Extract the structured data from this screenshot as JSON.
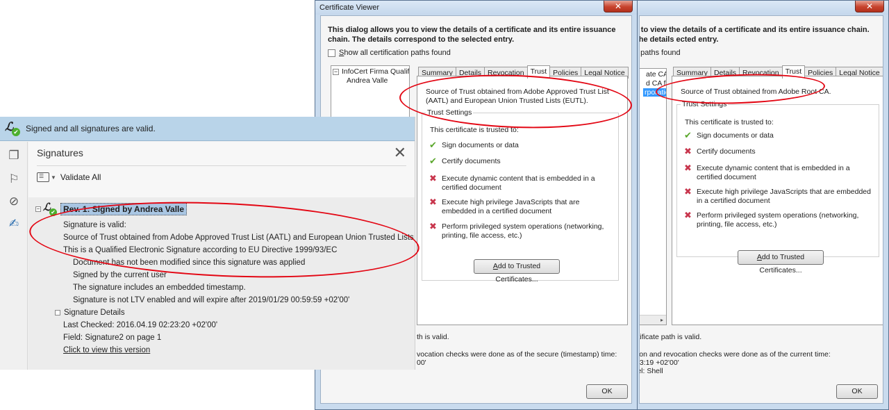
{
  "dialog": {
    "title": "Certificate Viewer",
    "close_symbol": "✕",
    "description": "This dialog allows you to view the details of a certificate and its entire issuance chain. The details correspond to the selected entry.",
    "show_all_paths_label": "Show all certification paths found",
    "tree": [
      {
        "expander": "−",
        "label": "InfoCert Firma Qualificata"
      },
      {
        "label": "Andrea Valle"
      }
    ],
    "tabs": [
      "Summary",
      "Details",
      "Revocation",
      "Trust",
      "Policies",
      "Legal Notice"
    ],
    "active_tab": "Trust",
    "trust_source": "Source of Trust obtained from Adobe Approved Trust List (AATL) and European Union Trusted Lists (EUTL).",
    "trust_settings_label": "Trust Settings",
    "trusted_to_label": "This certificate is trusted to:",
    "permissions": [
      {
        "status": "allowed",
        "label": "Sign documents or data"
      },
      {
        "status": "allowed",
        "label": "Certify documents"
      },
      {
        "status": "denied",
        "label": "Execute dynamic content that is embedded in a certified document"
      },
      {
        "status": "denied",
        "label": "Execute high privilege JavaScripts that are embedded in a certified document"
      },
      {
        "status": "denied",
        "label": "Perform privileged system operations (networking, printing, file access, etc.)"
      }
    ],
    "add_trusted_button": "Add to Trusted Certificates...",
    "path_status": "th is valid.",
    "revocation_line": "vocation checks were done as of the secure (timestamp) time:",
    "revocation_time": "00'",
    "ok_button": "OK"
  },
  "dialog_back": {
    "close_symbol": "✕",
    "description": "u to view the details of a certificate and its entire issuance chain. The details ected entry.",
    "show_all_paths_label": "n paths found",
    "tree": [
      "ate CA f",
      "d CA fo",
      "rporatio"
    ],
    "tree_scroll_arrow": "▸",
    "tabs": [
      "Summary",
      "Details",
      "Revocation",
      "Trust",
      "Policies",
      "Legal Notice"
    ],
    "trust_source": "Source of Trust obtained from Adobe Root CA.",
    "trust_settings_label": "Trust Settings",
    "trusted_to_label": "This certificate is trusted to:",
    "permissions": [
      {
        "status": "allowed",
        "label": "Sign documents or data"
      },
      {
        "status": "denied",
        "label": "Certify documents"
      },
      {
        "status": "denied",
        "label": "Execute dynamic content that is embedded in a certified document"
      },
      {
        "status": "denied",
        "label": "Execute high privilege JavaScripts that are embedded in a certified document"
      },
      {
        "status": "denied",
        "label": "Perform privileged system operations (networking, printing, file access, etc.)"
      }
    ],
    "add_trusted_button": "Add to Trusted Certificates...",
    "path_status": "rtificate path is valid.",
    "revocation_line": "tion and revocation checks were done as of the current time:",
    "revocation_time": "23:19 +02'00'",
    "label_line": "lel: Shell",
    "ok_button": "OK"
  },
  "acrobat": {
    "banner_text": "Signed and all signatures are valid.",
    "panel_title": "Signatures",
    "panel_close_symbol": "✕",
    "validate_all_label": "Validate All",
    "revision_label": "Rev. 1: Signed by Andrea Valle",
    "signature_lines": [
      "Signature is valid:",
      "Source of Trust obtained from Adobe Approved Trust List (AATL) and European Union Trusted Lists (EUTL).",
      "This is a Qualified Electronic Signature according to EU Directive 1999/93/EC",
      "Document has not been modified since this signature was applied",
      "Signed by the current user",
      "The signature includes an embedded timestamp.",
      "Signature is not LTV enabled and will expire after 2019/01/29 00:59:59 +02'00'"
    ],
    "details_label": "Signature Details",
    "last_checked": "Last Checked: 2016.04.19 02:23:20 +02'00'",
    "field": "Field: Signature2 on page 1",
    "view_version_link": "Click to view this version"
  },
  "icons": {
    "allowed": "✔",
    "denied": "✖",
    "signature_ok": "signature-valid-icon"
  },
  "colors": {
    "annotation_red": "#e30613",
    "banner_blue": "#b9d4e9",
    "valid_green": "#4caf2e",
    "denied_red": "#c8364d"
  }
}
